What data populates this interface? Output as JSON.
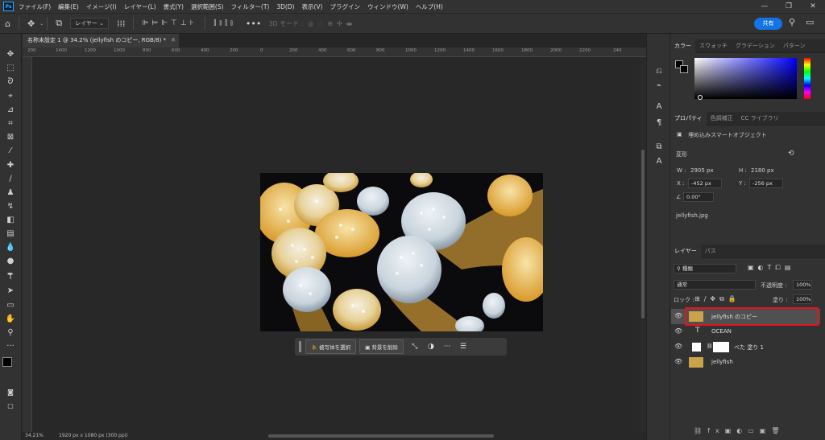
{
  "menu": [
    "ファイル(F)",
    "編集(E)",
    "イメージ(I)",
    "レイヤー(L)",
    "書式(Y)",
    "選択範囲(S)",
    "フィルター(T)",
    "3D(D)",
    "表示(V)",
    "プラグイン",
    "ウィンドウ(W)",
    "ヘルプ(H)"
  ],
  "app_icon": "Ps",
  "options": {
    "layer_select": "レイヤー",
    "mode_3d": "3D モード :",
    "share_label": "共有"
  },
  "document": {
    "tab_title": "名称未設定 1 @ 34.2% (jellyfish のコピー, RGB/8) *",
    "zoom": "34.21%",
    "size_info": "1920 px x 1080 px (300 ppi)"
  },
  "ruler": [
    "200",
    "1400",
    "1200",
    "1000",
    "800",
    "600",
    "400",
    "200",
    "0",
    "200",
    "400",
    "600",
    "800",
    "1000",
    "1200",
    "1400",
    "1600",
    "1800",
    "2000",
    "2200",
    "240"
  ],
  "taskbar": {
    "select_subject": "被写体を選択",
    "remove_bg": "背景を削除"
  },
  "color_panel": {
    "tabs": [
      "カラー",
      "スウォッチ",
      "グラデーション",
      "パターン"
    ],
    "hue_color": "#0000ff"
  },
  "properties_panel": {
    "tabs": [
      "プロパティ",
      "色調補正",
      "CC ライブラリ"
    ],
    "kind": "埋め込みスマートオブジェクト",
    "section": "変形",
    "w_label": "W :",
    "w_value": "2905 px",
    "h_label": "H :",
    "h_value": "2180 px",
    "x_label": "X :",
    "x_value": "-452 px",
    "y_label": "Y :",
    "y_value": "-256 px",
    "angle_value": "0.00°",
    "filename": "jellyfish.jpg"
  },
  "layers_panel": {
    "tabs": [
      "レイヤー",
      "パス"
    ],
    "filter": "種類",
    "blend_mode": "通常",
    "opacity_label": "不透明度 :",
    "opacity_value": "100%",
    "lock_label": "ロック :",
    "fill_label": "塗り :",
    "fill_value": "100%",
    "layers": [
      {
        "name": "jellyfish のコピー",
        "selected": true
      },
      {
        "name": "OCEAN",
        "selected": false
      },
      {
        "name": "べた 塗り 1",
        "selected": false
      },
      {
        "name": "jellyfish",
        "selected": false
      }
    ],
    "highlight_color": "#e3141c"
  }
}
